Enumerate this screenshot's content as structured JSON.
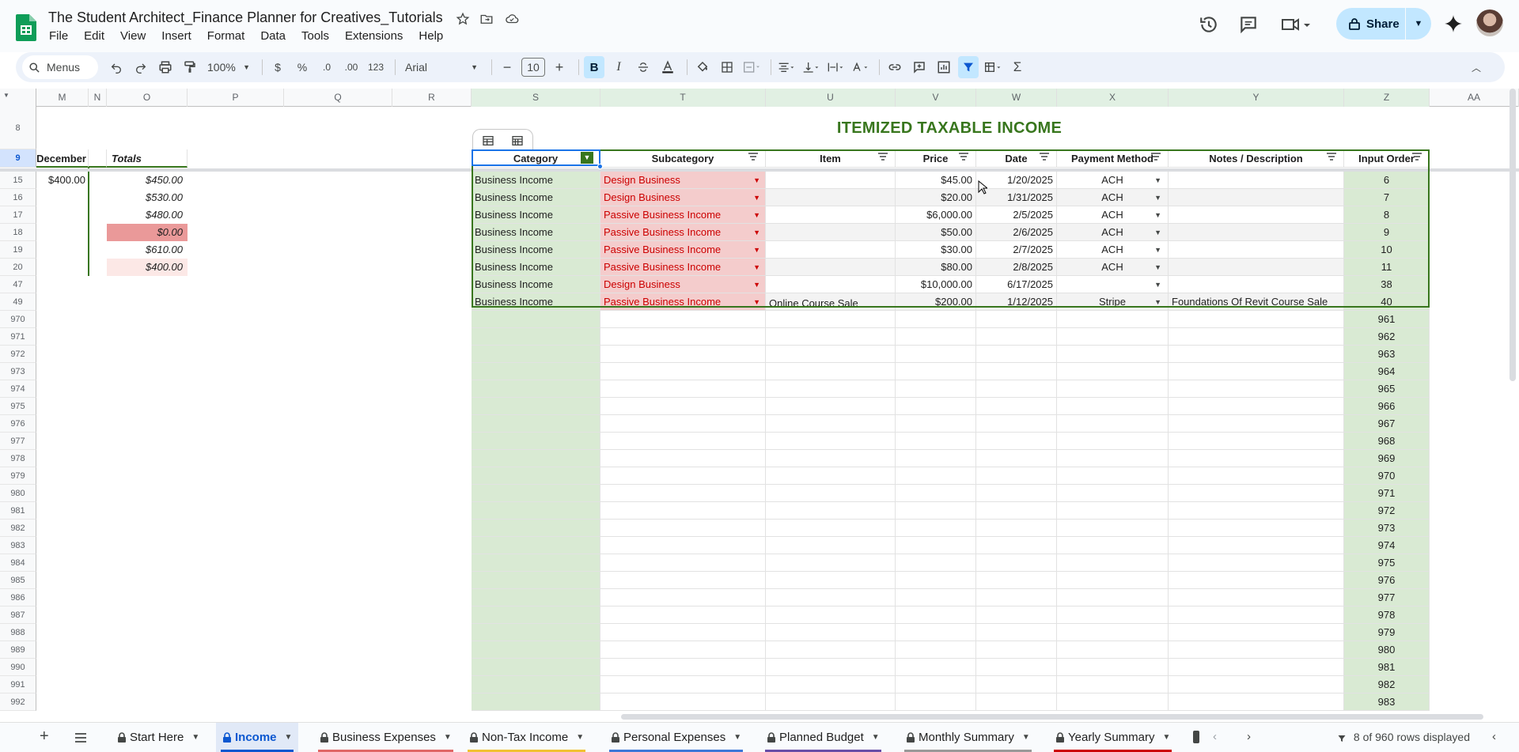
{
  "title": "The Student Architect_Finance Planner for Creatives_Tutorials",
  "menu": [
    "File",
    "Edit",
    "View",
    "Insert",
    "Format",
    "Data",
    "Tools",
    "Extensions",
    "Help"
  ],
  "share_label": "Share",
  "toolbar": {
    "search": "Menus",
    "zoom": "100%",
    "currency": "$",
    "percent": "%",
    "dec_less": ".0",
    "dec_more": ".00",
    "format_123": "123",
    "font": "Arial",
    "font_size": "10",
    "bold": "B",
    "italic": "I"
  },
  "columns": [
    {
      "letter": "M"
    },
    {
      "letter": "N"
    },
    {
      "letter": "O"
    },
    {
      "letter": "P"
    },
    {
      "letter": "Q"
    },
    {
      "letter": "R"
    },
    {
      "letter": "S"
    },
    {
      "letter": "T"
    },
    {
      "letter": "U"
    },
    {
      "letter": "V"
    },
    {
      "letter": "W"
    },
    {
      "letter": "X"
    },
    {
      "letter": "Y"
    },
    {
      "letter": "Z"
    },
    {
      "letter": "AA"
    }
  ],
  "left": {
    "december_label": "December",
    "totals_label": "Totals",
    "december_value": "$400.00",
    "totals": [
      "$450.00",
      "$530.00",
      "$480.00",
      "$0.00",
      "$610.00",
      "$400.00"
    ]
  },
  "table": {
    "title": "ITEMIZED TAXABLE INCOME",
    "headers": [
      "Category",
      "Subcategory",
      "Item",
      "Price",
      "Date",
      "Payment Method",
      "Notes / Description",
      "Input Order"
    ],
    "rows": [
      {
        "row": "15",
        "category": "Business Income",
        "subcategory": "Design Business",
        "item": "",
        "price": "$45.00",
        "date": "1/20/2025",
        "payment": "ACH",
        "notes": "",
        "order": "6"
      },
      {
        "row": "16",
        "category": "Business Income",
        "subcategory": "Design Business",
        "item": "",
        "price": "$20.00",
        "date": "1/31/2025",
        "payment": "ACH",
        "notes": "",
        "order": "7"
      },
      {
        "row": "17",
        "category": "Business Income",
        "subcategory": "Passive Business Income",
        "item": "",
        "price": "$6,000.00",
        "date": "2/5/2025",
        "payment": "ACH",
        "notes": "",
        "order": "8"
      },
      {
        "row": "18",
        "category": "Business Income",
        "subcategory": "Passive Business Income",
        "item": "",
        "price": "$50.00",
        "date": "2/6/2025",
        "payment": "ACH",
        "notes": "",
        "order": "9"
      },
      {
        "row": "19",
        "category": "Business Income",
        "subcategory": "Passive Business Income",
        "item": "",
        "price": "$30.00",
        "date": "2/7/2025",
        "payment": "ACH",
        "notes": "",
        "order": "10"
      },
      {
        "row": "20",
        "category": "Business Income",
        "subcategory": "Passive Business Income",
        "item": "",
        "price": "$80.00",
        "date": "2/8/2025",
        "payment": "ACH",
        "notes": "",
        "order": "11"
      },
      {
        "row": "47",
        "category": "Business Income",
        "subcategory": "Design Business",
        "item": "",
        "price": "$10,000.00",
        "date": "6/17/2025",
        "payment": "",
        "notes": "",
        "order": "38"
      },
      {
        "row": "49",
        "category": "Business Income",
        "subcategory": "Passive Business Income",
        "item": "Online Course Sale",
        "price": "$200.00",
        "date": "1/12/2025",
        "payment": "Stripe",
        "notes": "Foundations Of Revit Course Sale",
        "order": "40"
      }
    ]
  },
  "top_rows": [
    "8",
    "9"
  ],
  "empty_rows": [
    {
      "row": "970",
      "order": "961"
    },
    {
      "row": "971",
      "order": "962"
    },
    {
      "row": "972",
      "order": "963"
    },
    {
      "row": "973",
      "order": "964"
    },
    {
      "row": "974",
      "order": "965"
    },
    {
      "row": "975",
      "order": "966"
    },
    {
      "row": "976",
      "order": "967"
    },
    {
      "row": "977",
      "order": "968"
    },
    {
      "row": "978",
      "order": "969"
    },
    {
      "row": "979",
      "order": "970"
    },
    {
      "row": "980",
      "order": "971"
    },
    {
      "row": "981",
      "order": "972"
    },
    {
      "row": "982",
      "order": "973"
    },
    {
      "row": "983",
      "order": "974"
    },
    {
      "row": "984",
      "order": "975"
    },
    {
      "row": "985",
      "order": "976"
    },
    {
      "row": "986",
      "order": "977"
    },
    {
      "row": "987",
      "order": "978"
    },
    {
      "row": "988",
      "order": "979"
    },
    {
      "row": "989",
      "order": "980"
    },
    {
      "row": "990",
      "order": "981"
    },
    {
      "row": "991",
      "order": "982"
    },
    {
      "row": "992",
      "order": "983"
    }
  ],
  "sheets": [
    {
      "name": "Start Here",
      "color": "#f9fbfd"
    },
    {
      "name": "Income",
      "color": "#0b57d0",
      "active": true
    },
    {
      "name": "Business Expenses",
      "color": "#e06666"
    },
    {
      "name": "Non-Tax Income",
      "color": "#f1c232"
    },
    {
      "name": "Personal Expenses",
      "color": "#3c78d8"
    },
    {
      "name": "Planned Budget",
      "color": "#674ea7"
    },
    {
      "name": "Monthly Summary",
      "color": "#999999"
    },
    {
      "name": "Yearly Summary",
      "color": "#cc0000"
    }
  ],
  "rows_displayed": "8 of 960 rows displayed",
  "colors": {
    "table_green": "#38761d",
    "light_green": "#d9ead3",
    "pink": "#f4cccc",
    "red_text": "#cc0000",
    "accent": "#0b57d0"
  }
}
